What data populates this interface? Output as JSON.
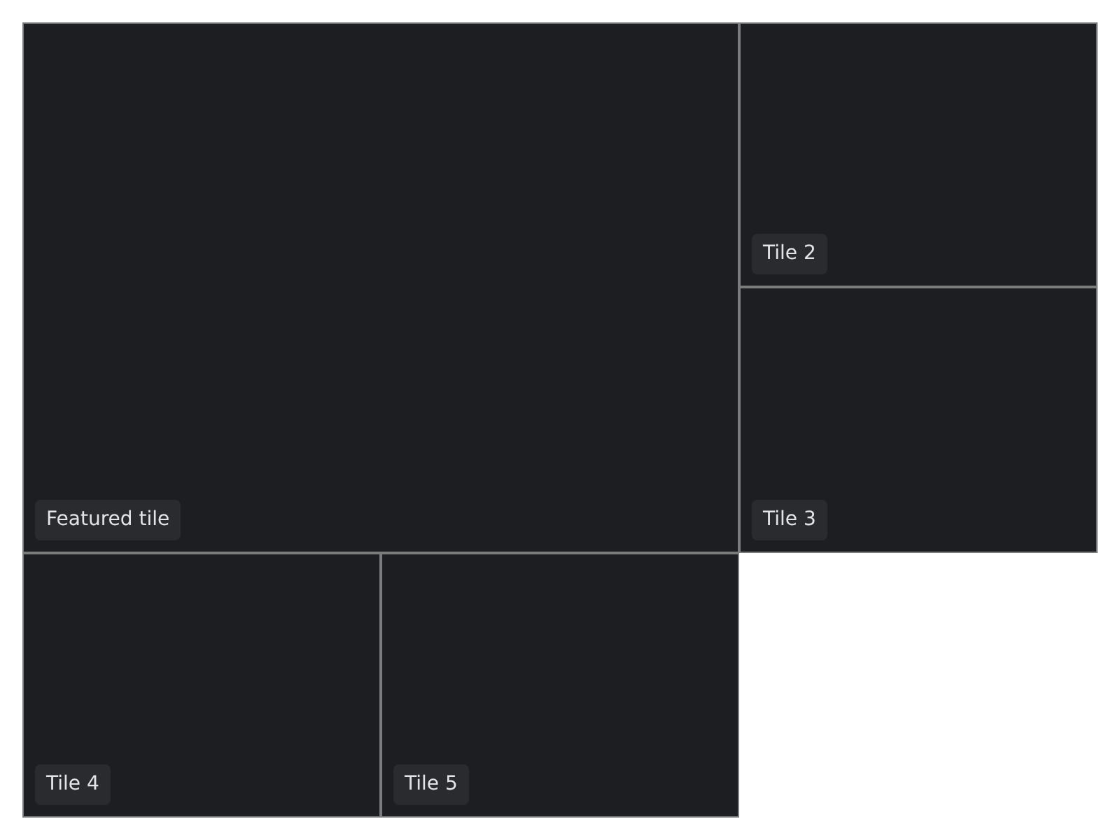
{
  "tiles": [
    {
      "label": "Featured tile",
      "kind": "featured"
    },
    {
      "label": "Tile 2",
      "kind": "standard"
    },
    {
      "label": "Tile 3",
      "kind": "standard"
    },
    {
      "label": "Tile 4",
      "kind": "standard"
    },
    {
      "label": "Tile 5",
      "kind": "standard"
    }
  ]
}
